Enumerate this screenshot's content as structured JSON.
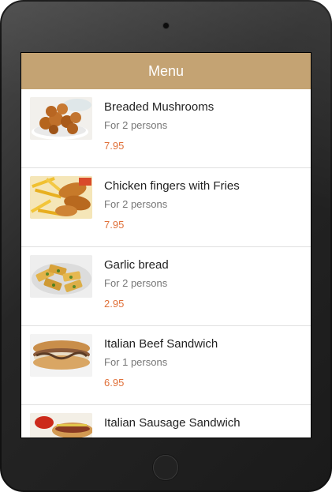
{
  "app_bar": {
    "title": "Menu"
  },
  "menu": {
    "items": [
      {
        "name": "Breaded Mushrooms",
        "serves": "For 2 persons",
        "price": "7.95",
        "image_icon": "breaded-mushrooms-photo"
      },
      {
        "name": "Chicken fingers with Fries",
        "serves": "For 2 persons",
        "price": "7.95",
        "image_icon": "chicken-fingers-photo"
      },
      {
        "name": "Garlic bread",
        "serves": "For 2 persons",
        "price": "2.95",
        "image_icon": "garlic-bread-photo"
      },
      {
        "name": "Italian Beef Sandwich",
        "serves": "For 1 persons",
        "price": "6.95",
        "image_icon": "italian-beef-sandwich-photo"
      },
      {
        "name": "Italian Sausage Sandwich",
        "serves": "",
        "price": "",
        "image_icon": "italian-sausage-sandwich-photo"
      }
    ]
  },
  "colors": {
    "app_bar": "#c4a373",
    "price": "#e0713a",
    "device": "#262626"
  }
}
